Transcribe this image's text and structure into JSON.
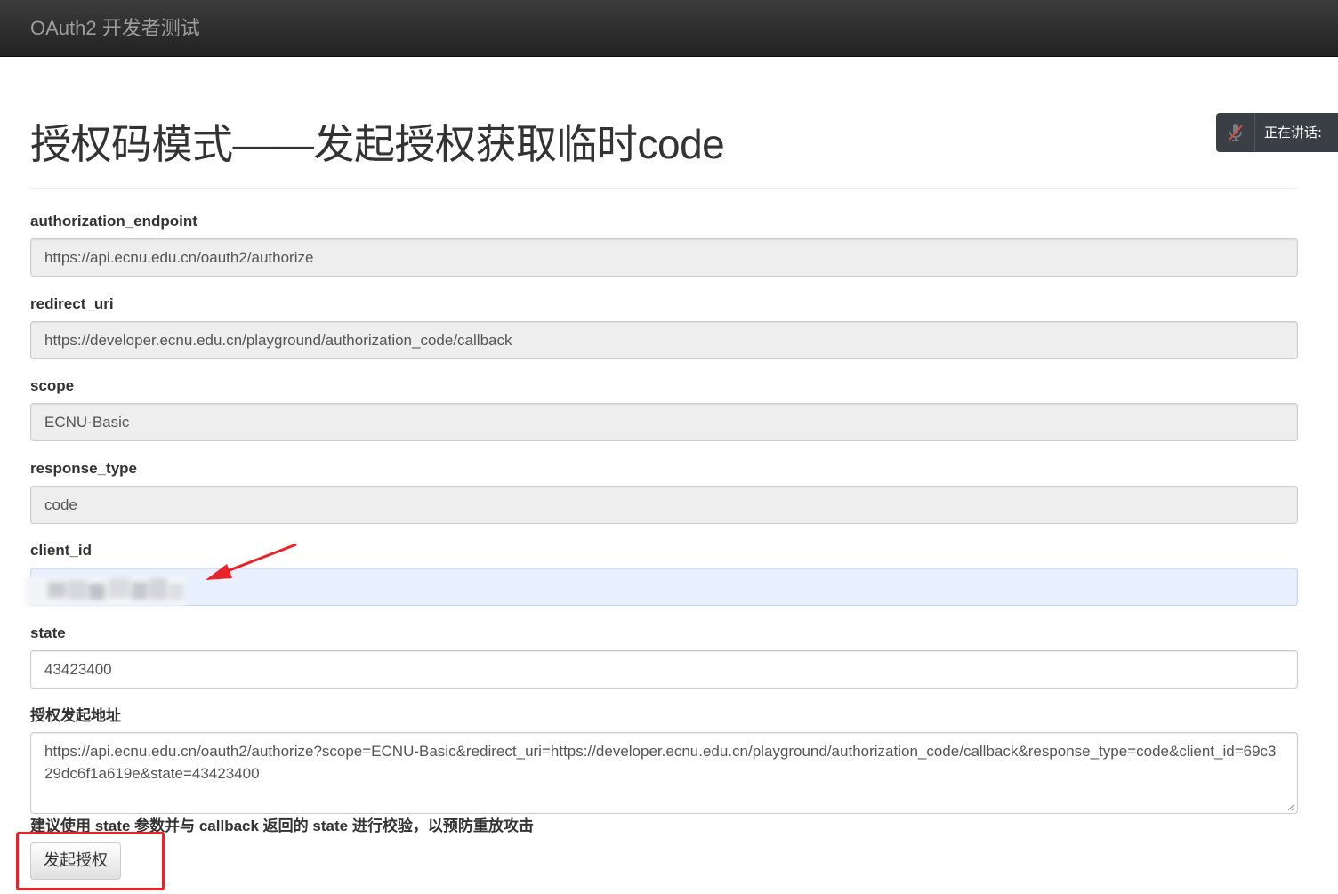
{
  "navbar": {
    "brand": "OAuth2 开发者测试"
  },
  "page": {
    "title": "授权码模式——发起授权获取临时code"
  },
  "speaking_widget": {
    "label": "正在讲话:",
    "icon": "mic-muted-icon"
  },
  "fields": {
    "authorization_endpoint": {
      "label": "authorization_endpoint",
      "value": "https://api.ecnu.edu.cn/oauth2/authorize"
    },
    "redirect_uri": {
      "label": "redirect_uri",
      "value": "https://developer.ecnu.edu.cn/playground/authorization_code/callback"
    },
    "scope": {
      "label": "scope",
      "value": "ECNU-Basic"
    },
    "response_type": {
      "label": "response_type",
      "value": "code"
    },
    "client_id": {
      "label": "client_id",
      "value": ""
    },
    "state": {
      "label": "state",
      "value": "43423400"
    },
    "auth_url": {
      "label": "授权发起地址",
      "value": "https://api.ecnu.edu.cn/oauth2/authorize?scope=ECNU-Basic&redirect_uri=https://developer.ecnu.edu.cn/playground/authorization_code/callback&response_type=code&client_id=69c329dc6f1a619e&state=43423400"
    }
  },
  "hint": "建议使用 state 参数并与 callback 返回的 state 进行校验，以预防重放攻击",
  "submit_button": "发起授权",
  "colors": {
    "annotation_red": "#e8242a",
    "navbar_bg": "#222222",
    "autofill_bg": "#e8f0fe"
  }
}
